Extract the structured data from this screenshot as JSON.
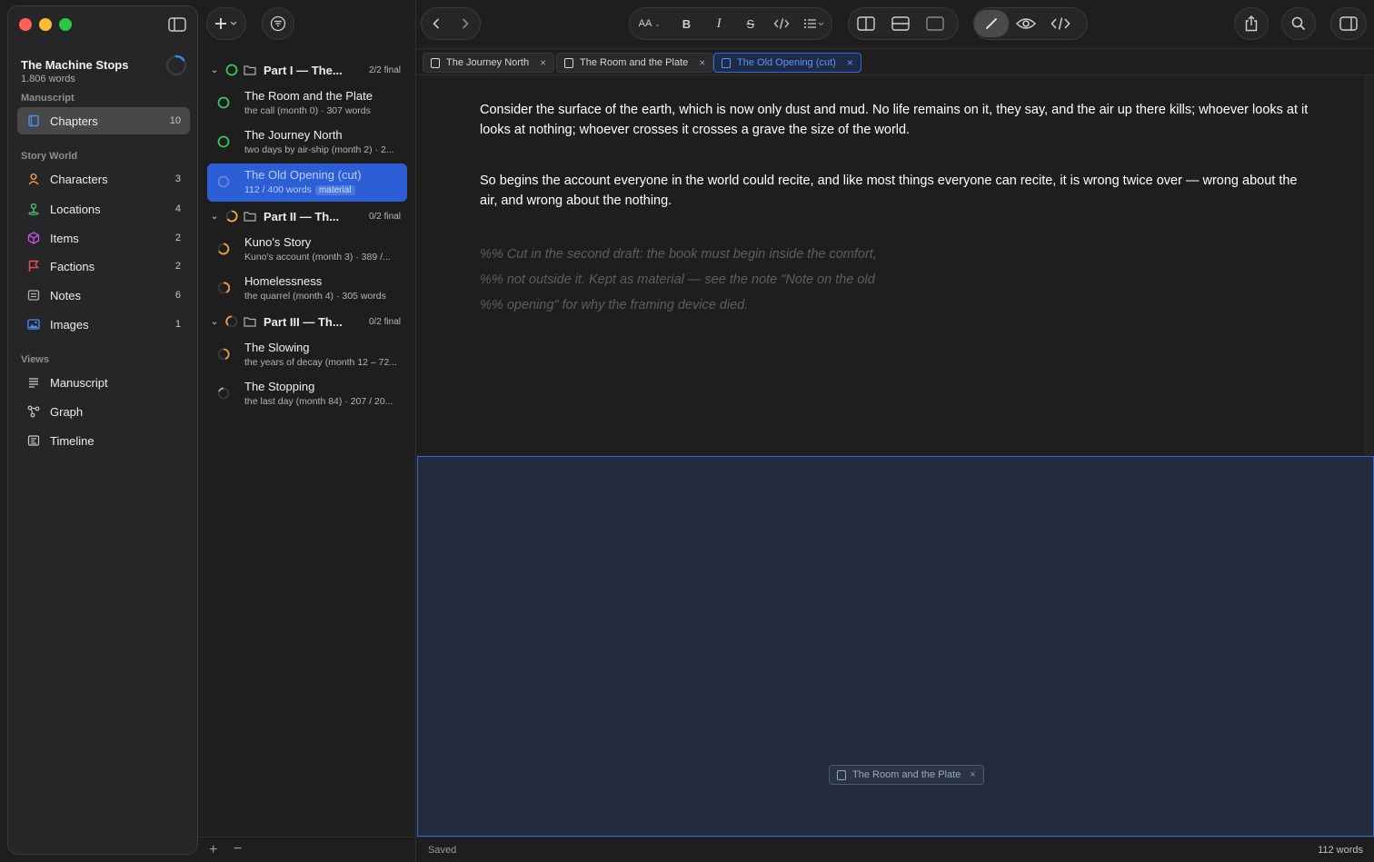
{
  "sidebar": {
    "project_title": "The Machine Stops",
    "project_words": "1.806 words",
    "section_manuscript": "Manuscript",
    "section_story_world": "Story World",
    "section_views": "Views",
    "chapters": {
      "label": "Chapters",
      "count": "10"
    },
    "story_world": [
      {
        "label": "Characters",
        "count": "3",
        "icon": "person-icon",
        "color": "#f0a040"
      },
      {
        "label": "Locations",
        "count": "4",
        "icon": "pin-icon",
        "color": "#4cc26a"
      },
      {
        "label": "Items",
        "count": "2",
        "icon": "cube-icon",
        "color": "#c058e8"
      },
      {
        "label": "Factions",
        "count": "2",
        "icon": "flag-icon",
        "color": "#e85050"
      },
      {
        "label": "Notes",
        "count": "6",
        "icon": "note-icon",
        "color": "#b0b0b0"
      },
      {
        "label": "Images",
        "count": "1",
        "icon": "image-icon",
        "color": "#4a8ef0"
      }
    ],
    "views": [
      {
        "label": "Manuscript",
        "icon": "lines-icon"
      },
      {
        "label": "Graph",
        "icon": "graph-icon"
      },
      {
        "label": "Timeline",
        "icon": "timeline-icon"
      }
    ]
  },
  "tree": {
    "groups": [
      {
        "title": "Part I — The...",
        "final": "2/2 final"
      },
      {
        "title": "Part II — Th...",
        "final": "0/2 final"
      },
      {
        "title": "Part III — Th...",
        "final": "0/2 final"
      }
    ],
    "chapters": [
      {
        "title": "The Room and the Plate",
        "sub": "the call (month 0) · 307 words"
      },
      {
        "title": "The Journey North",
        "sub": "two days by air-ship (month 2) · 2..."
      },
      {
        "title": "The Old Opening (cut)",
        "sub": "112 / 400 words",
        "tag": "material"
      },
      {
        "title": "Kuno's Story",
        "sub": "Kuno's account (month 3) · 389 /..."
      },
      {
        "title": "Homelessness",
        "sub": "the quarrel (month 4) · 305 words"
      },
      {
        "title": "The Slowing",
        "sub": "the years of decay (month 12 – 72..."
      },
      {
        "title": "The Stopping",
        "sub": "the last day (month 84) · 207 / 20..."
      }
    ]
  },
  "toolbar": {
    "font_size_label": "AA",
    "bold_label": "B",
    "italic_label": "I",
    "strike_label": "S"
  },
  "tabs": [
    {
      "label": "The Journey North"
    },
    {
      "label": "The Room and the Plate"
    },
    {
      "label": "The Old Opening (cut)"
    }
  ],
  "editor": {
    "para1": "Consider the surface of the earth, which is now only dust and mud. No life remains on it, they say, and the air up there kills; whoever looks at it looks at nothing; whoever crosses it crosses a grave the size of the world.",
    "para2": "So begins the account everyone in the world could recite, and like most things everyone can recite, it is wrong twice over — wrong about the air, and wrong about the nothing.",
    "comment1": "%% Cut in the second draft: the book must begin inside the comfort,",
    "comment2": "%% not outside it. Kept as material — see the note \"Note on the old",
    "comment3": "%% opening\" for why the framing device died."
  },
  "drop_tab": {
    "label": "The Room and the Plate"
  },
  "status": {
    "saved": "Saved",
    "words": "112 words"
  }
}
